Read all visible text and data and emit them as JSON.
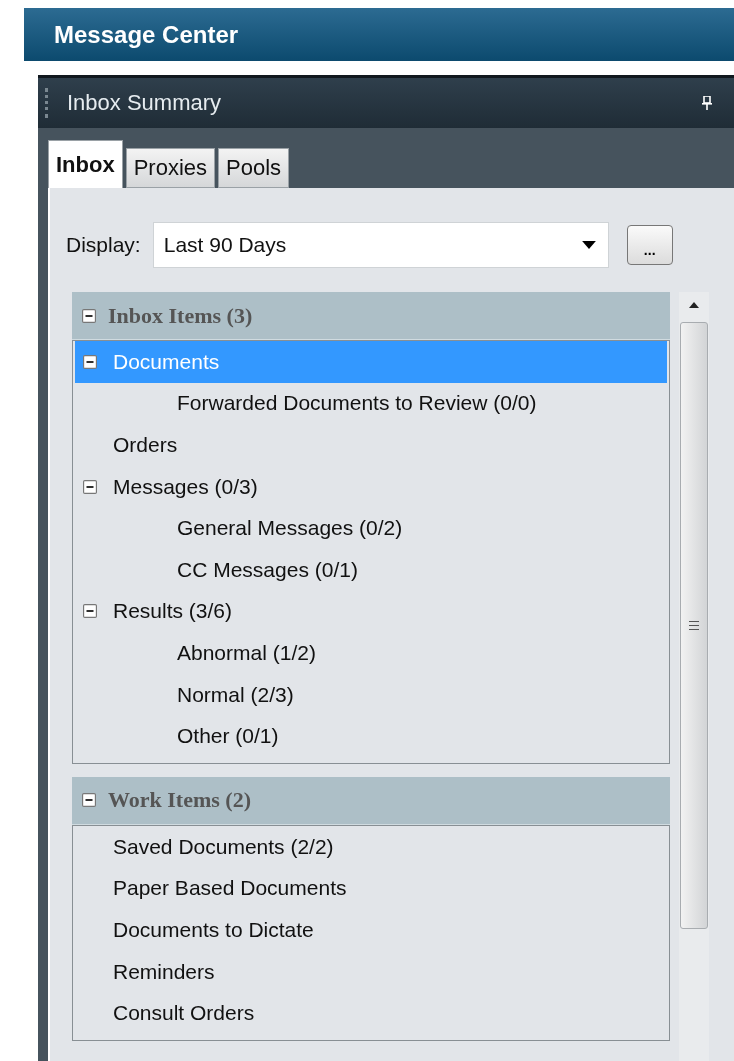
{
  "window": {
    "title": "Message Center"
  },
  "panel": {
    "title": "Inbox Summary"
  },
  "tabs": [
    {
      "label": "Inbox",
      "selected": true
    },
    {
      "label": "Proxies",
      "selected": false
    },
    {
      "label": "Pools",
      "selected": false
    }
  ],
  "display": {
    "label": "Display:",
    "value": "Last 90 Days",
    "more_button": "..."
  },
  "sections": [
    {
      "title": "Inbox Items (3)",
      "expanded": true,
      "items": [
        {
          "label": "Documents",
          "selected": true,
          "expanded": true,
          "children": [
            {
              "label": "Forwarded Documents to Review (0/0)",
              "selected": false
            }
          ]
        },
        {
          "label": "Orders",
          "selected": false
        },
        {
          "label": "Messages (0/3)",
          "selected": false,
          "expanded": true,
          "children": [
            {
              "label": "General Messages (0/2)",
              "selected": false
            },
            {
              "label": "CC Messages (0/1)",
              "selected": false
            }
          ]
        },
        {
          "label": "Results (3/6)",
          "selected": false,
          "expanded": true,
          "children": [
            {
              "label": "Abnormal (1/2)",
              "selected": false
            },
            {
              "label": "Normal (2/3)",
              "selected": false
            },
            {
              "label": "Other (0/1)",
              "selected": false
            }
          ]
        }
      ]
    },
    {
      "title": "Work Items (2)",
      "expanded": true,
      "items": [
        {
          "label": "Saved Documents (2/2)",
          "selected": false
        },
        {
          "label": "Paper Based Documents",
          "selected": false
        },
        {
          "label": "Documents to Dictate",
          "selected": false
        },
        {
          "label": "Reminders",
          "selected": false
        },
        {
          "label": "Consult Orders",
          "selected": false
        }
      ]
    }
  ]
}
